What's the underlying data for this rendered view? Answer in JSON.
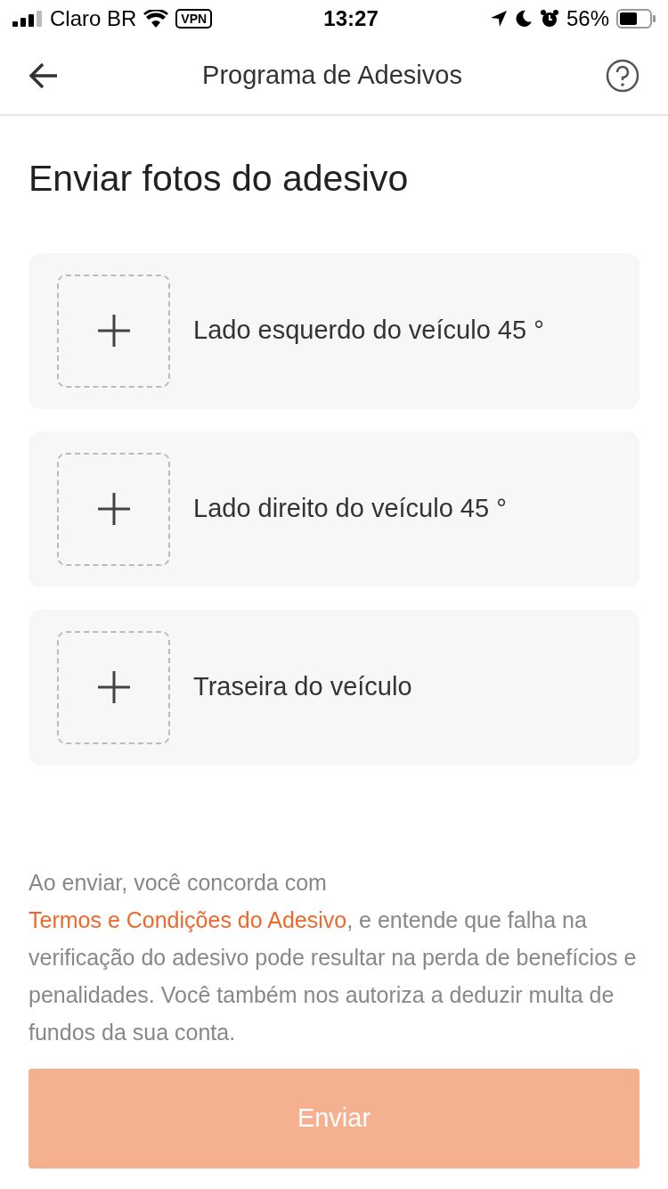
{
  "status_bar": {
    "carrier": "Claro BR",
    "vpn": "VPN",
    "time": "13:27",
    "battery_text": "56%"
  },
  "header": {
    "title": "Programa de Adesivos"
  },
  "page_title": "Enviar fotos do adesivo",
  "photo_slots": [
    {
      "label": "Lado esquerdo do veículo 45 °"
    },
    {
      "label": "Lado direito do veículo 45 °"
    },
    {
      "label": "Traseira do veículo"
    }
  ],
  "disclaimer": {
    "before": "Ao enviar, você concorda com ",
    "link": "Termos e Condições do Adesivo",
    "after": ", e entende que falha na verificação do adesivo pode resultar na perda de benefícios e penalidades. Você também nos autoriza a deduzir multa de fundos da sua conta."
  },
  "submit": {
    "label": "Enviar",
    "disabled": true
  }
}
